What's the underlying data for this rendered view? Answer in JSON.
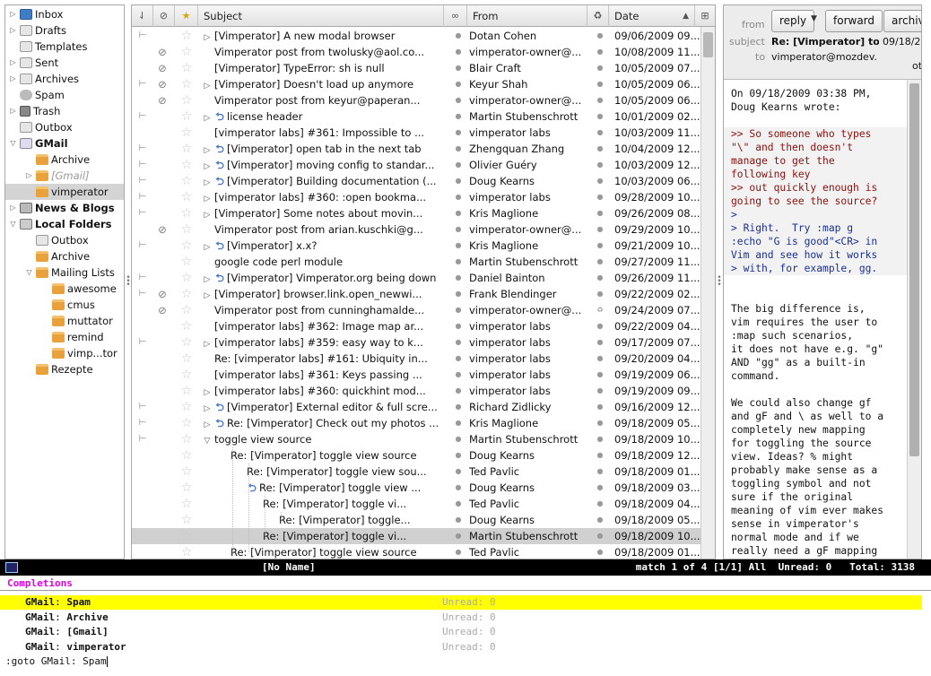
{
  "folders": [
    {
      "label": "Inbox",
      "indent": 0,
      "twisty": "right",
      "icon": "inbox-icon",
      "style": ""
    },
    {
      "label": "Drafts",
      "indent": 0,
      "twisty": "right",
      "icon": "drafts-icon",
      "style": ""
    },
    {
      "label": "Templates",
      "indent": 0,
      "twisty": "",
      "icon": "templates-icon",
      "style": ""
    },
    {
      "label": "Sent",
      "indent": 0,
      "twisty": "right",
      "icon": "sent-icon",
      "style": ""
    },
    {
      "label": "Archives",
      "indent": 0,
      "twisty": "right",
      "icon": "archives-icon",
      "style": ""
    },
    {
      "label": "Spam",
      "indent": 0,
      "twisty": "",
      "icon": "spam-icon",
      "style": ""
    },
    {
      "label": "Trash",
      "indent": 0,
      "twisty": "right",
      "icon": "trash-icon",
      "style": ""
    },
    {
      "label": "Outbox",
      "indent": 0,
      "twisty": "",
      "icon": "outbox-icon",
      "style": ""
    },
    {
      "label": "GMail",
      "indent": 0,
      "twisty": "down",
      "icon": "account-icon",
      "style": "bold"
    },
    {
      "label": "Archive",
      "indent": 1,
      "twisty": "",
      "icon": "folder-icon",
      "style": ""
    },
    {
      "label": "[Gmail]",
      "indent": 1,
      "twisty": "right",
      "icon": "folder-icon",
      "style": "dim"
    },
    {
      "label": "vimperator",
      "indent": 1,
      "twisty": "",
      "icon": "folder-icon",
      "style": "",
      "selected": true
    },
    {
      "label": "News & Blogs",
      "indent": 0,
      "twisty": "right",
      "icon": "news-icon",
      "style": "bold"
    },
    {
      "label": "Local Folders",
      "indent": 0,
      "twisty": "down",
      "icon": "local-folders-icon",
      "style": "bold"
    },
    {
      "label": "Outbox",
      "indent": 1,
      "twisty": "",
      "icon": "outbox-icon",
      "style": ""
    },
    {
      "label": "Archive",
      "indent": 1,
      "twisty": "",
      "icon": "folder-icon",
      "style": ""
    },
    {
      "label": "Mailing Lists",
      "indent": 1,
      "twisty": "down",
      "icon": "folder-icon",
      "style": ""
    },
    {
      "label": "awesome",
      "indent": 2,
      "twisty": "",
      "icon": "folder-icon",
      "style": ""
    },
    {
      "label": "cmus",
      "indent": 2,
      "twisty": "",
      "icon": "folder-icon",
      "style": ""
    },
    {
      "label": "muttator",
      "indent": 2,
      "twisty": "",
      "icon": "folder-icon",
      "style": ""
    },
    {
      "label": "remind",
      "indent": 2,
      "twisty": "",
      "icon": "folder-icon",
      "style": ""
    },
    {
      "label": "vimp...tor",
      "indent": 2,
      "twisty": "",
      "icon": "folder-icon",
      "style": ""
    },
    {
      "label": "Rezepte",
      "indent": 1,
      "twisty": "",
      "icon": "folder-icon",
      "style": ""
    }
  ],
  "list_header": {
    "thread_icon": "thread-column-icon",
    "attachment_icon": "attachment-column-icon",
    "star_icon": "star-column-icon",
    "subject": "Subject",
    "read_icon": "read-status-column-icon",
    "from": "From",
    "junk_icon": "junk-column-icon",
    "date": "Date",
    "sort_icon": "sort-ascending-icon",
    "picker_icon": "column-picker-icon"
  },
  "messages": [
    {
      "thread": true,
      "att": false,
      "twisty": "right",
      "replied": false,
      "level": 0,
      "subject": "[Vimperator] A new modal browser",
      "from": "Dotan Cohen",
      "date": "09/06/2009 09..."
    },
    {
      "thread": false,
      "att": true,
      "twisty": "",
      "replied": false,
      "level": 0,
      "subject": "Vimperator post from twolusky@aol.co...",
      "from": "vimperator-owner@...",
      "date": "10/08/2009 11..."
    },
    {
      "thread": false,
      "att": true,
      "twisty": "",
      "replied": false,
      "level": 0,
      "subject": "[Vimperator] TypeError: sh is null",
      "from": "Blair Craft",
      "date": "10/05/2009 07..."
    },
    {
      "thread": true,
      "att": true,
      "twisty": "right",
      "replied": false,
      "level": 0,
      "subject": "[Vimperator] Doesn't load up anymore",
      "from": "Keyur Shah",
      "date": "10/05/2009 06..."
    },
    {
      "thread": false,
      "att": true,
      "twisty": "",
      "replied": false,
      "level": 0,
      "subject": "Vimperator post from keyur@paperan...",
      "from": "vimperator-owner@...",
      "date": "10/05/2009 06..."
    },
    {
      "thread": true,
      "att": false,
      "twisty": "right",
      "replied": true,
      "level": 0,
      "subject": "license header",
      "from": "Martin Stubenschrott",
      "date": "10/01/2009 02..."
    },
    {
      "thread": false,
      "att": false,
      "twisty": "",
      "replied": false,
      "level": 0,
      "subject": "[vimperator labs] #361: Impossible to ...",
      "from": "vimperator labs",
      "date": "10/03/2009 11..."
    },
    {
      "thread": true,
      "att": false,
      "twisty": "right",
      "replied": true,
      "level": 0,
      "subject": "[Vimperator] open tab in the next tab",
      "from": "Zhengquan Zhang",
      "date": "10/04/2009 12..."
    },
    {
      "thread": true,
      "att": false,
      "twisty": "right",
      "replied": true,
      "level": 0,
      "subject": "[Vimperator] moving config to standar...",
      "from": "Olivier Guéry",
      "date": "10/03/2009 12..."
    },
    {
      "thread": true,
      "att": false,
      "twisty": "right",
      "replied": true,
      "level": 0,
      "subject": "[Vimperator] Building documentation (...",
      "from": "Doug Kearns",
      "date": "10/03/2009 06..."
    },
    {
      "thread": true,
      "att": false,
      "twisty": "right",
      "replied": false,
      "level": 0,
      "subject": "[vimperator labs] #360: :open bookma...",
      "from": "vimperator labs",
      "date": "09/28/2009 10..."
    },
    {
      "thread": true,
      "att": false,
      "twisty": "right",
      "replied": false,
      "level": 0,
      "subject": "[Vimperator] Some notes about movin...",
      "from": "Kris Maglione",
      "date": "09/26/2009 08..."
    },
    {
      "thread": false,
      "att": true,
      "twisty": "",
      "replied": false,
      "level": 0,
      "subject": "Vimperator post from arian.kuschki@g...",
      "from": "vimperator-owner@...",
      "date": "09/29/2009 10..."
    },
    {
      "thread": true,
      "att": false,
      "twisty": "right",
      "replied": true,
      "level": 0,
      "subject": "[Vimperator] x.x?",
      "from": "Kris Maglione",
      "date": "09/21/2009 10..."
    },
    {
      "thread": false,
      "att": false,
      "twisty": "",
      "replied": false,
      "level": 0,
      "subject": "google code perl module",
      "from": "Martin Stubenschrott",
      "date": "09/27/2009 11..."
    },
    {
      "thread": true,
      "att": false,
      "twisty": "right",
      "replied": true,
      "level": 0,
      "subject": "[Vimperator] Vimperator.org being down",
      "from": "Daniel Bainton",
      "date": "09/26/2009 11..."
    },
    {
      "thread": true,
      "att": true,
      "twisty": "right",
      "replied": false,
      "level": 0,
      "subject": "[Vimperator] browser.link.open_newwi...",
      "from": "Frank Blendinger",
      "date": "09/22/2009 02..."
    },
    {
      "thread": false,
      "att": true,
      "twisty": "",
      "replied": false,
      "level": 0,
      "subject": "Vimperator post from cunninghamalde...",
      "from": "vimperator-owner@...",
      "date": "09/24/2009 07...",
      "junk": true
    },
    {
      "thread": false,
      "att": false,
      "twisty": "",
      "replied": false,
      "level": 0,
      "subject": "[vimperator labs] #362: Image map ar...",
      "from": "vimperator labs",
      "date": "09/22/2009 04..."
    },
    {
      "thread": true,
      "att": false,
      "twisty": "right",
      "replied": false,
      "level": 0,
      "subject": "[vimperator labs] #359: easy way to k...",
      "from": "vimperator labs",
      "date": "09/17/2009 07..."
    },
    {
      "thread": false,
      "att": false,
      "twisty": "",
      "replied": false,
      "level": 0,
      "subject": "Re: [vimperator labs] #161: Ubiquity in...",
      "from": "vimperator labs",
      "date": "09/20/2009 04..."
    },
    {
      "thread": false,
      "att": false,
      "twisty": "",
      "replied": false,
      "level": 0,
      "subject": "[vimperator labs] #361: Keys passing ...",
      "from": "vimperator labs",
      "date": "09/19/2009 06..."
    },
    {
      "thread": false,
      "att": false,
      "twisty": "right",
      "replied": false,
      "level": 0,
      "subject": "[vimperator labs] #360: quickhint mod...",
      "from": "vimperator labs",
      "date": "09/19/2009 09..."
    },
    {
      "thread": true,
      "att": false,
      "twisty": "right",
      "replied": true,
      "level": 0,
      "subject": "[Vimperator] External editor & full scre...",
      "from": "Richard Zidlicky",
      "date": "09/16/2009 12..."
    },
    {
      "thread": true,
      "att": false,
      "twisty": "right",
      "replied": true,
      "level": 0,
      "subject": "Re: [Vimperator] Check out my photos ...",
      "from": "Kris Maglione",
      "date": "09/18/2009 05..."
    },
    {
      "thread": true,
      "att": false,
      "twisty": "down",
      "replied": false,
      "level": 0,
      "subject": "toggle view source",
      "from": "Martin Stubenschrott",
      "date": "09/18/2009 10..."
    },
    {
      "thread": false,
      "att": false,
      "twisty": "",
      "replied": false,
      "level": 1,
      "subject": "Re: [Vimperator] toggle view source",
      "from": "Doug Kearns",
      "date": "09/18/2009 12..."
    },
    {
      "thread": false,
      "att": false,
      "twisty": "",
      "replied": false,
      "level": 2,
      "subject": "Re: [Vimperator] toggle view sou...",
      "from": "Ted Pavlic",
      "date": "09/18/2009 01..."
    },
    {
      "thread": false,
      "att": false,
      "twisty": "",
      "replied": true,
      "level": 2,
      "subject": "Re: [Vimperator] toggle view ...",
      "from": "Doug Kearns",
      "date": "09/18/2009 03..."
    },
    {
      "thread": false,
      "att": false,
      "twisty": "",
      "replied": false,
      "level": 3,
      "subject": "Re: [Vimperator] toggle vi...",
      "from": "Ted Pavlic",
      "date": "09/18/2009 04..."
    },
    {
      "thread": false,
      "att": false,
      "twisty": "",
      "replied": false,
      "level": 4,
      "subject": "Re: [Vimperator] toggle...",
      "from": "Doug Kearns",
      "date": "09/18/2009 05..."
    },
    {
      "thread": false,
      "att": false,
      "twisty": "",
      "replied": false,
      "level": 3,
      "subject": "Re: [Vimperator] toggle vi...",
      "from": "Martin Stubenschrott",
      "date": "09/18/2009 10...",
      "selected": true
    },
    {
      "thread": false,
      "att": false,
      "twisty": "",
      "replied": false,
      "level": 1,
      "subject": "Re: [Vimperator] toggle view source",
      "from": "Ted Pavlic",
      "date": "09/18/2009 01..."
    }
  ],
  "preview": {
    "buttons": {
      "reply": "reply",
      "forward": "forward",
      "archive": "archive"
    },
    "from_label": "from",
    "subject_label": "subject",
    "to_label": "to",
    "subject": "Re: [Vimperator] to",
    "date": "09/18/2",
    "to": "vimperator@mozdev.",
    "other": "ot",
    "body_intro": "On 09/18/2009 03:38 PM,\nDoug Kearns wrote:",
    "quote1": ">> So someone who types\n\"\\\" and then doesn't\nmanage to get the\nfollowing key\n>> out quickly enough is\ngoing to see the source?",
    "quote2": ">\n> Right.  Try :map g\n:echo \"G is good\"<CR> in\nVim and see how it works\n> with, for example, gg.",
    "body_rest": "\n\nThe big difference is,\nvim requires the user to\n:map such scenarios,\nit does not have e.g. \"g\"\nAND \"gg\" as a built-in\ncommand.\n\nWe could also change gf\nand gF and \\ as well to a\ncompletely new mapping\nfor toggling the source\nview. Ideas? % might\nprobably make sense as a\ntoggling symbol and not\nsure if the original\nmeaning of vim ever makes\nsense in vimperator's\nnormal mode and if we\nreally need a gF mapping"
  },
  "statusline": {
    "icon": "vimperator-status-icon",
    "buffer": "[No Name]",
    "right": "match 1 of 4 [1/1] All  Unread: 0   Total: 3138"
  },
  "completions": {
    "title": "Completions",
    "items": [
      {
        "folder": "GMail",
        "sep": ": ",
        "name": "Spam",
        "unread": "Unread: 0",
        "highlight": true
      },
      {
        "folder": "GMail",
        "sep": ": ",
        "name": "Archive",
        "unread": "Unread: 0"
      },
      {
        "folder": "GMail",
        "sep": ": ",
        "name": "[Gmail]",
        "unread": "Unread: 0"
      },
      {
        "folder": "GMail",
        "sep": ": ",
        "name": "vimperator",
        "unread": "Unread: 0"
      }
    ]
  },
  "commandline": ":goto GMail: Spam"
}
